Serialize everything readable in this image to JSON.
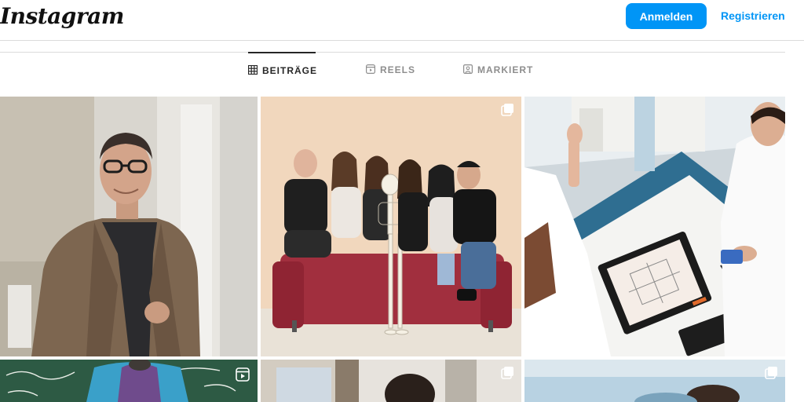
{
  "header": {
    "logo_text": "Instagram",
    "login_label": "Anmelden",
    "register_label": "Registrieren"
  },
  "tabs": [
    {
      "label": "BEITRÄGE",
      "icon": "grid-icon",
      "active": true
    },
    {
      "label": "REELS",
      "icon": "reels-icon",
      "active": false
    },
    {
      "label": "MARKIERT",
      "icon": "tagged-icon",
      "active": false
    }
  ],
  "posts": [
    {
      "type": "photo",
      "badge": null
    },
    {
      "type": "carousel",
      "badge": "carousel-icon"
    },
    {
      "type": "photo",
      "badge": null
    },
    {
      "type": "reel",
      "badge": "reel-icon"
    },
    {
      "type": "carousel",
      "badge": "carousel-icon"
    },
    {
      "type": "carousel",
      "badge": "carousel-icon"
    }
  ],
  "colors": {
    "accent": "#0095f6",
    "border": "#dbdbdb",
    "text": "#262626",
    "muted": "#8e8e8e"
  }
}
